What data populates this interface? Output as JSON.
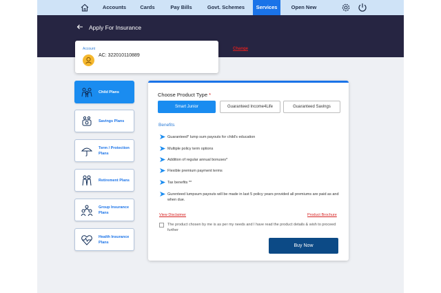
{
  "nav": {
    "items": [
      {
        "label": "Accounts"
      },
      {
        "label": "Cards"
      },
      {
        "label": "Pay Bills"
      },
      {
        "label": "Govt. Schemes"
      },
      {
        "label": "Services",
        "active": true
      },
      {
        "label": "Open New"
      }
    ],
    "icons": {
      "home": "home-icon",
      "settings": "gear-icon",
      "logout": "power-icon"
    }
  },
  "header": {
    "title": "Apply For Insurance"
  },
  "account": {
    "label": "Account",
    "number": "AC: 322010110889",
    "change_label": "Change"
  },
  "plans": [
    {
      "label": "Child Plans",
      "icon": "child-family-icon",
      "active": true
    },
    {
      "label": "Savings Plans",
      "icon": "savings-icon"
    },
    {
      "label": "Term / Protection Plans",
      "icon": "umbrella-icon"
    },
    {
      "label": "Retirement Plans",
      "icon": "retirement-icon"
    },
    {
      "label": "Group Insurance Plans",
      "icon": "group-icon"
    },
    {
      "label": "Health Insurance Plans",
      "icon": "health-icon"
    }
  ],
  "product": {
    "choose_label": "Choose Product Type",
    "required_mark": "*",
    "types": [
      {
        "label": "Smart Junior",
        "active": true
      },
      {
        "label": "Guaranteed Income4Life"
      },
      {
        "label": "Guaranteed Savings"
      }
    ],
    "benefits_title": "Benefits",
    "benefits": [
      "Guaranteed* lump sum payouts for child's education",
      "Multiple policy term options",
      "Addition of regular annual bonuses*",
      "Flexible premium payment terms",
      "Tax benefits **",
      "Gurenteed lumpsum payouts will be made in last 5 policy years provided all premiums are paid as and when due."
    ],
    "disclaimer_link": "View Disclaimer",
    "brochure_link": "Product Brochure",
    "consent_text": "The product chosen by me is as per my needs and I have read the product details & wish to proceed further",
    "buy_label": "Buy Now"
  },
  "colors": {
    "nav_bg": "#cfe3f7",
    "nav_active": "#1a73e8",
    "header_bg": "#262542",
    "accent": "#1a8cf0",
    "link_red": "#d62020",
    "buy_button": "#0c4a86"
  }
}
